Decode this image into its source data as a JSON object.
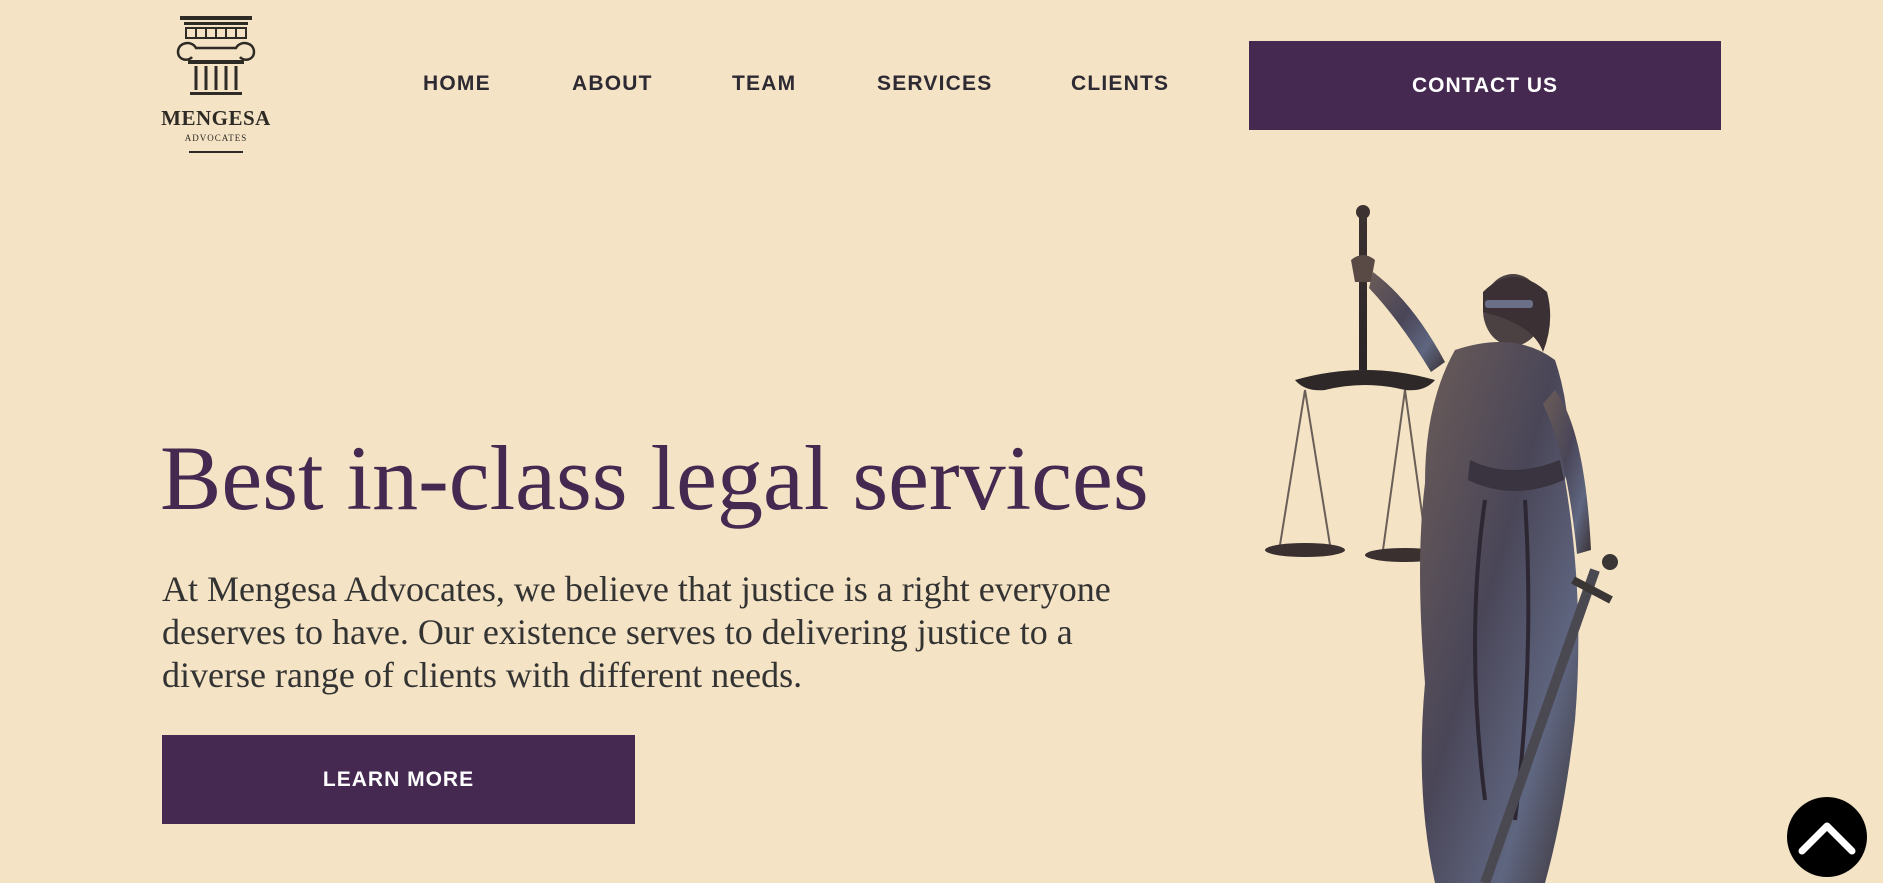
{
  "brand": {
    "name": "MENGESA",
    "tagline": "ADVOCATES"
  },
  "nav": {
    "items": [
      {
        "label": "HOME"
      },
      {
        "label": "ABOUT"
      },
      {
        "label": "TEAM"
      },
      {
        "label": "SERVICES"
      },
      {
        "label": "CLIENTS"
      }
    ],
    "cta_label": "CONTACT US"
  },
  "hero": {
    "title": "Best in-class legal services",
    "text": "At Mengesa Advocates, we believe that justice is a right everyone deserves to have. Our existence serves to delivering justice to a diverse range of clients with different needs.",
    "button_label": "LEARN MORE",
    "image_icon": "lady-justice-statue"
  },
  "scroll_top": {
    "icon": "chevron-up-icon"
  },
  "colors": {
    "background": "#f4e3c4",
    "accent": "#462951",
    "text": "#333333"
  }
}
